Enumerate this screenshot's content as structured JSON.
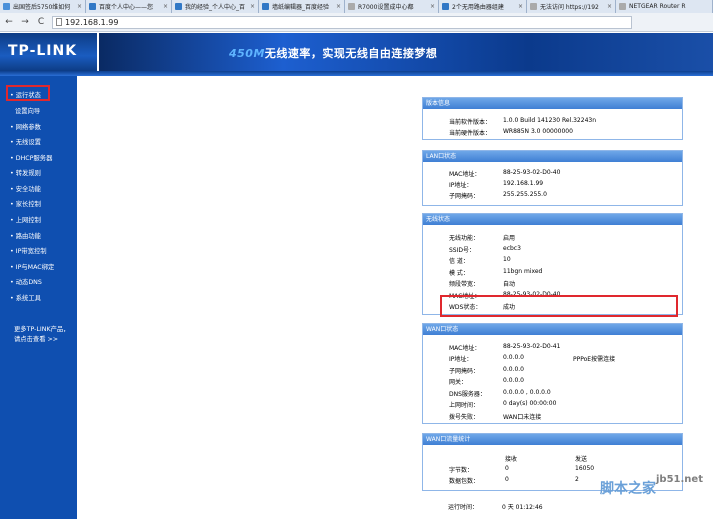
{
  "browser": {
    "tabs": [
      {
        "label": "出国签后5750维如何",
        "color": "#4a90d9"
      },
      {
        "label": "百度个人中心——您",
        "color": "#3178c6"
      },
      {
        "label": "我的经验_个人中心_百",
        "color": "#3178c6"
      },
      {
        "label": "墙纸编辑器_百度经验",
        "color": "#3178c6"
      },
      {
        "label": "R7000设置成中心都",
        "color": "#aaaaaa"
      },
      {
        "label": "2个无用路由器组建",
        "color": "#3178c6"
      },
      {
        "label": "无法访问 https://192",
        "color": "#aaaaaa"
      },
      {
        "label": "NETGEAR Router R",
        "color": "#aaaaaa"
      }
    ],
    "url": "192.168.1.99"
  },
  "header": {
    "logo": "TP-LINK",
    "banner_speed": "450M",
    "banner_text": "无线速率，实现无线自由连接梦想"
  },
  "sidebar": {
    "items": [
      {
        "label": "运行状态"
      },
      {
        "label": "设置向导"
      },
      {
        "label": "网络参数"
      },
      {
        "label": "无线设置"
      },
      {
        "label": "DHCP服务器"
      },
      {
        "label": "转发规则"
      },
      {
        "label": "安全功能"
      },
      {
        "label": "家长控制"
      },
      {
        "label": "上网控制"
      },
      {
        "label": "路由功能"
      },
      {
        "label": "IP带宽控制"
      },
      {
        "label": "IP与MAC绑定"
      },
      {
        "label": "动态DNS"
      },
      {
        "label": "系统工具"
      }
    ],
    "more_line1": "更多TP-LINK产品，",
    "more_line2": "请点击查看 >>"
  },
  "panels": {
    "version": {
      "title": "版本信息",
      "rows": [
        {
          "label": "当前软件版本：",
          "value": "1.0.0 Build 141230 Rel.32243n"
        },
        {
          "label": "当前硬件版本：",
          "value": "WR885N 3.0 00000000"
        }
      ]
    },
    "lan": {
      "title": "LAN口状态",
      "rows": [
        {
          "label": "MAC地址：",
          "value": "88-25-93-02-D0-40"
        },
        {
          "label": "IP地址：",
          "value": "192.168.1.99"
        },
        {
          "label": "子网掩码：",
          "value": "255.255.255.0"
        }
      ]
    },
    "wireless": {
      "title": "无线状态",
      "rows": [
        {
          "label": "无线功能：",
          "value": "启用"
        },
        {
          "label": "SSID号：",
          "value": "ecbc3"
        },
        {
          "label": "信 道：",
          "value": "10"
        },
        {
          "label": "模 式：",
          "value": "11bgn mixed"
        },
        {
          "label": "频段带宽：",
          "value": "自动"
        },
        {
          "label": "MAC地址：",
          "value": "88-25-93-02-D0-40"
        },
        {
          "label": "WDS状态：",
          "value": "成功"
        }
      ]
    },
    "wan": {
      "title": "WAN口状态",
      "rows": [
        {
          "label": "MAC地址：",
          "value": "88-25-93-02-D0-41",
          "extra": ""
        },
        {
          "label": "IP地址：",
          "value": "0.0.0.0",
          "extra": "PPPoE按需连接"
        },
        {
          "label": "子网掩码：",
          "value": "0.0.0.0",
          "extra": ""
        },
        {
          "label": "网关：",
          "value": "0.0.0.0",
          "extra": ""
        },
        {
          "label": "DNS服务器：",
          "value": "0.0.0.0 , 0.0.0.0",
          "extra": ""
        },
        {
          "label": "上网时间：",
          "value": "0 day(s) 00:00:00",
          "extra": ""
        },
        {
          "label": "拨号失败：",
          "value": "WAN口未连接",
          "extra": ""
        }
      ]
    },
    "wan_stats": {
      "title": "WAN口流量统计",
      "col_recv": "接收",
      "col_send": "发送",
      "rows": [
        {
          "label": "字节数：",
          "recv": "0",
          "send": "16050"
        },
        {
          "label": "数据包数：",
          "recv": "0",
          "send": "2"
        }
      ]
    },
    "uptime": {
      "label": "运行时间：",
      "value": "0 天 01:12:46"
    }
  },
  "watermark": {
    "brand": "脚本之家",
    "site": "jb51.net"
  }
}
